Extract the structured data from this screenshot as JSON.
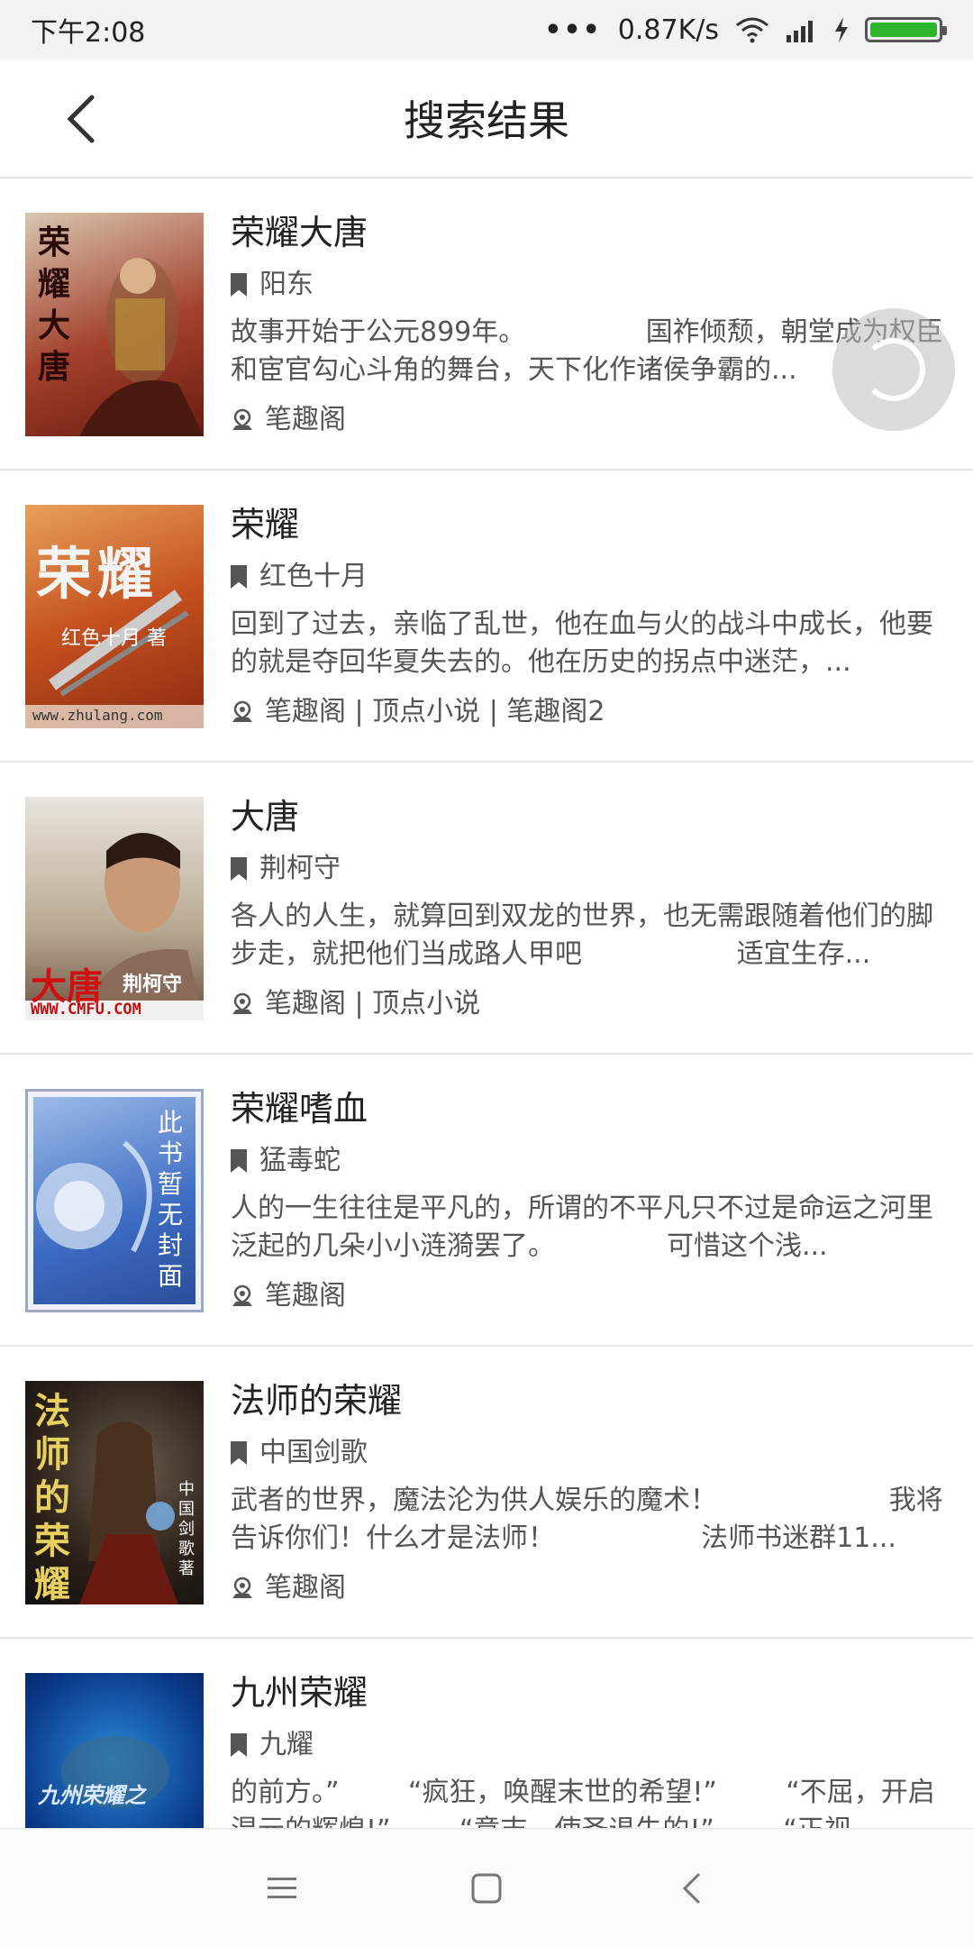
{
  "status_bar": {
    "time": "下午2:08",
    "dots": "•••",
    "speed": "0.87K/s"
  },
  "header": {
    "title": "搜索结果"
  },
  "results": [
    {
      "title": "荣耀大唐",
      "author": "阳东",
      "description": "故事开始于公元899年。              国祚倾颓，朝堂成为权臣和宦官勾心斗角的舞台，天下化作诸侯争霸的...",
      "sources": "笔趣阁",
      "cover_text": "荣耀大唐",
      "cover_colors": [
        "#7a1a12",
        "#c94a2a"
      ]
    },
    {
      "title": "荣耀",
      "author": "红色十月",
      "description": "回到了过去，亲临了乱世，他在血与火的战斗中成长，他要的就是夺回华夏失去的。他在历史的拐点中迷茫，...",
      "sources": "笔趣阁 | 顶点小说 | 笔趣阁2",
      "cover_text": "荣耀",
      "cover_sub": "红色十月 著",
      "cover_url": "www.zhulang.com",
      "cover_colors": [
        "#b8441f",
        "#e07a3a"
      ]
    },
    {
      "title": "大唐",
      "author": "荆柯守",
      "description": "各人的人生，就算回到双龙的世界，也无需跟随着他们的脚步走，就把他们当成路人甲吧                  适宜生存...",
      "sources": "笔趣阁 | 顶点小说",
      "cover_text": "大唐",
      "cover_sub": "荆柯守",
      "cover_url": "WWW.CMFU.COM",
      "cover_colors": [
        "#c9c3b8",
        "#7c6a58"
      ]
    },
    {
      "title": "荣耀嗜血",
      "author": "猛毒蛇",
      "description": "人的一生往往是平凡的，所谓的不平凡只不过是命运之河里泛起的几朵小小涟漪罢了。             可惜这个浅...",
      "sources": "笔趣阁",
      "cover_text": "此书暂无封面",
      "cover_colors": [
        "#3c6bc2",
        "#8fb2e8"
      ]
    },
    {
      "title": "法师的荣耀",
      "author": "中国剑歌",
      "description": "武者的世界，魔法沦为供人娱乐的魔术！                    我将告诉你们！什么才是法师！                 法师书迷群11...",
      "sources": "笔趣阁",
      "cover_text": "法师的荣耀",
      "cover_sub": "中国剑歌 著",
      "cover_colors": [
        "#1a1a1a",
        "#5a4a3a"
      ]
    },
    {
      "title": "九州荣耀",
      "author": "九耀",
      "description": "的前方。”        “疯狂，唤醒末世的希望!”        “不屈，开启混元的辉煌!”        “意志，使圣退失的!”        “正视...",
      "sources": "",
      "cover_text": "九州荣耀之",
      "cover_colors": [
        "#0a2a6a",
        "#3a6ac8"
      ]
    }
  ],
  "navbar": {
    "menu": "menu-icon",
    "home": "home-icon",
    "back": "back-icon"
  }
}
